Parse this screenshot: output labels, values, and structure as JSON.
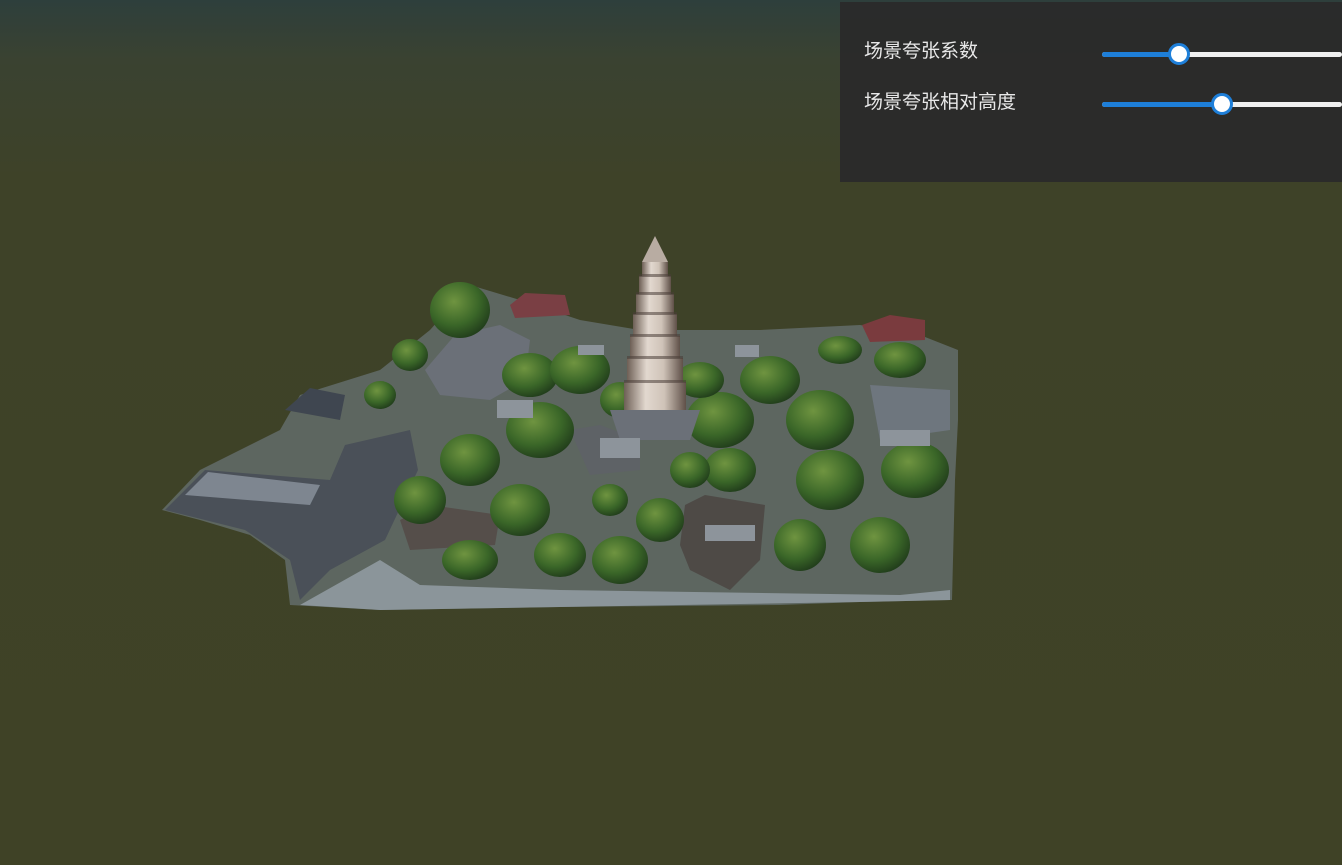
{
  "toolbar": {
    "controls": [
      {
        "label": "场景夸张系数",
        "value": 0.32
      },
      {
        "label": "场景夸张相对高度",
        "value": 0.5
      }
    ]
  },
  "colors": {
    "accent": "#1e7fd9",
    "panel_background": "#2a2a2a",
    "ground": "#3f4226",
    "sky": "#2e3f3c"
  },
  "scene": {
    "description_icon": "pagoda-3d-model"
  }
}
